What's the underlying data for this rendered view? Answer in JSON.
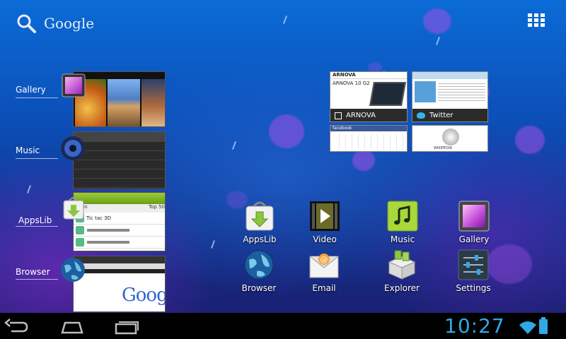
{
  "search": {
    "label": "Google",
    "icon": "search-icon"
  },
  "all_apps": {
    "icon": "all-apps-grid-icon"
  },
  "recent_apps": [
    {
      "label": "Gallery",
      "icon": "gallery-icon"
    },
    {
      "label": "Music",
      "icon": "music-icon"
    },
    {
      "label": "AppsLib",
      "icon": "appslib-icon"
    },
    {
      "label": "Browser",
      "icon": "browser-icon"
    }
  ],
  "recent_thumbs": {
    "appslib_title": "Top 50",
    "appslib_first_app": "Tic tac 3D",
    "browser_logo": "Google"
  },
  "widgets": {
    "arnova": "ARNOVA",
    "arnova_product": "ARNOVA 10 G2",
    "twitter": "Twitter",
    "facebook": "facebook",
    "wiki_logo": "WIKIPEDIA"
  },
  "apps": [
    {
      "label": "AppsLib",
      "icon": "appslib-icon"
    },
    {
      "label": "Video",
      "icon": "video-icon"
    },
    {
      "label": "Music",
      "icon": "music-icon"
    },
    {
      "label": "Gallery",
      "icon": "gallery-icon"
    },
    {
      "label": "Browser",
      "icon": "browser-icon"
    },
    {
      "label": "Email",
      "icon": "email-icon"
    },
    {
      "label": "Explorer",
      "icon": "explorer-icon"
    },
    {
      "label": "Settings",
      "icon": "settings-icon"
    }
  ],
  "status": {
    "time": "10:27",
    "accent": "#2fa8e6"
  }
}
